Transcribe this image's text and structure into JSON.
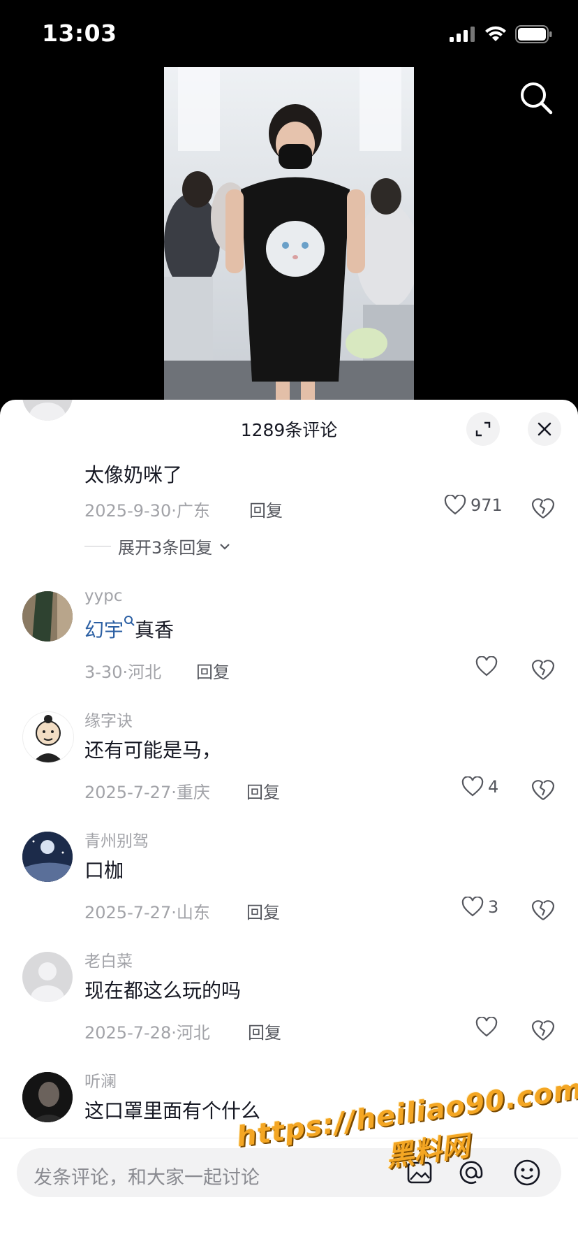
{
  "status": {
    "time": "13:03"
  },
  "header": {
    "title": "1289条评论"
  },
  "comments": [
    {
      "text": "太像奶咪了",
      "date": "2025-9-30",
      "location": "广东",
      "reply": "回复",
      "likes": "971",
      "expand": "展开3条回复"
    },
    {
      "username": "yypc",
      "link_text": "幻宇",
      "text": "真香",
      "date": "3-30",
      "location": "河北",
      "reply": "回复",
      "likes": ""
    },
    {
      "username": "缘字诀",
      "text": "还有可能是马，",
      "date": "2025-7-27",
      "location": "重庆",
      "reply": "回复",
      "likes": "4"
    },
    {
      "username": "青州别驾",
      "text": "口枷",
      "date": "2025-7-27",
      "location": "山东",
      "reply": "回复",
      "likes": "3"
    },
    {
      "username": "老白菜",
      "text": "现在都这么玩的吗",
      "date": "2025-7-28",
      "location": "河北",
      "reply": "回复",
      "likes": ""
    },
    {
      "username": "听澜",
      "text": "这口罩里面有个什么"
    }
  ],
  "input": {
    "placeholder": "发条评论，和大家一起讨论"
  },
  "watermark": {
    "url": "https://heiliao90.com",
    "name": "黑料网"
  },
  "colors": {
    "accent_link": "#2b5fa3",
    "watermark": "#f4a623"
  }
}
